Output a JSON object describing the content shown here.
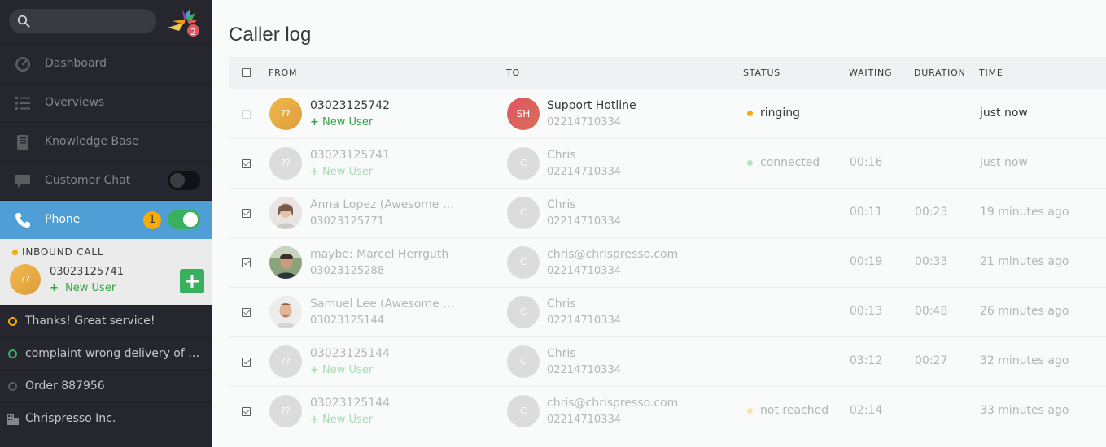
{
  "sidebar": {
    "search": {
      "placeholder": "",
      "value": ""
    },
    "logo_badge": "2",
    "nav": [
      {
        "label": "Dashboard",
        "icon": "dashboard-icon"
      },
      {
        "label": "Overviews",
        "icon": "list-icon"
      },
      {
        "label": "Knowledge Base",
        "icon": "book-icon"
      },
      {
        "label": "Customer Chat",
        "icon": "chat-icon",
        "toggle": false
      },
      {
        "label": "Phone",
        "icon": "phone-icon",
        "count": "1",
        "toggle": true,
        "active": true
      }
    ],
    "inbound": {
      "title": "INBOUND CALL",
      "avatar": "??",
      "number": "03023125741",
      "new_user": "New User"
    },
    "items": [
      {
        "label": "Thanks! Great service!",
        "icon": "ticket-open-icon",
        "color": "#faab00"
      },
      {
        "label": "complaint wrong delivery of ord...",
        "icon": "ticket-new-icon",
        "color": "#38ad69"
      },
      {
        "label": "Order 887956",
        "icon": "ticket-closed-icon",
        "color": "#5c5d60"
      },
      {
        "label": "Chrispresso Inc.",
        "icon": "organization-icon",
        "color": "#84868d"
      }
    ]
  },
  "main": {
    "title": "Caller log",
    "columns": [
      "FROM",
      "TO",
      "STATUS",
      "WAITING",
      "DURATION",
      "TIME"
    ],
    "rows": [
      {
        "checked": false,
        "from_avatar": "??",
        "from_avatar_type": "yellow",
        "from_name": "03023125742",
        "from_sub": "New User",
        "from_sub_is_link": true,
        "to_avatar": "SH",
        "to_avatar_type": "red",
        "to_name": "Support Hotline",
        "to_number": "02214710334",
        "status": "ringing",
        "status_color": "#faab00",
        "waiting": "",
        "duration": "",
        "time": "just now",
        "active": true
      },
      {
        "checked": true,
        "from_avatar": "??",
        "from_avatar_type": "grey",
        "from_name": "03023125741",
        "from_sub": "New User",
        "from_sub_is_link": true,
        "to_avatar": "C",
        "to_avatar_type": "grey",
        "to_name": "Chris",
        "to_number": "02214710334",
        "status": "connected",
        "status_color": "#b6e3c3",
        "waiting": "00:16",
        "duration": "",
        "time": "just now",
        "active": false
      },
      {
        "checked": true,
        "from_avatar": "",
        "from_avatar_type": "photo-woman",
        "from_name": "Anna Lopez (Awesome Cu...",
        "from_sub": "03023125771",
        "from_sub_is_link": false,
        "to_avatar": "C",
        "to_avatar_type": "grey",
        "to_name": "Chris",
        "to_number": "02214710334",
        "status": "",
        "status_color": "",
        "waiting": "00:11",
        "duration": "00:23",
        "time": "19 minutes ago",
        "active": false
      },
      {
        "checked": true,
        "from_avatar": "",
        "from_avatar_type": "photo-man-outdoor",
        "from_name": "maybe: Marcel Herrguth",
        "from_sub": "03023125288",
        "from_sub_is_link": false,
        "to_avatar": "C",
        "to_avatar_type": "grey",
        "to_name": "chris@chrispresso.com",
        "to_number": "02214710334",
        "status": "",
        "status_color": "",
        "waiting": "00:19",
        "duration": "00:33",
        "time": "21 minutes ago",
        "active": false
      },
      {
        "checked": true,
        "from_avatar": "",
        "from_avatar_type": "photo-man-beard",
        "from_name": "Samuel Lee (Awesome Cu...",
        "from_sub": "03023125144",
        "from_sub_is_link": false,
        "to_avatar": "C",
        "to_avatar_type": "grey",
        "to_name": "Chris",
        "to_number": "02214710334",
        "status": "",
        "status_color": "",
        "waiting": "00:13",
        "duration": "00:48",
        "time": "26 minutes ago",
        "active": false
      },
      {
        "checked": true,
        "from_avatar": "??",
        "from_avatar_type": "grey",
        "from_name": "03023125144",
        "from_sub": "New User",
        "from_sub_is_link": true,
        "to_avatar": "C",
        "to_avatar_type": "grey",
        "to_name": "Chris",
        "to_number": "02214710334",
        "status": "",
        "status_color": "",
        "waiting": "03:12",
        "duration": "00:27",
        "time": "32 minutes ago",
        "active": false
      },
      {
        "checked": true,
        "from_avatar": "??",
        "from_avatar_type": "grey",
        "from_name": "03023125144",
        "from_sub": "New User",
        "from_sub_is_link": true,
        "to_avatar": "C",
        "to_avatar_type": "grey",
        "to_name": "chris@chrispresso.com",
        "to_number": "02214710334",
        "status": "not reached",
        "status_color": "#fbe2a8",
        "waiting": "02:14",
        "duration": "",
        "time": "33 minutes ago",
        "active": false
      }
    ]
  },
  "colors": {
    "sidebar_bg": "#26272e",
    "accent": "#4f9ed5",
    "badge": "#faab00",
    "success": "#38b05e",
    "brand_red": "#e2565f"
  }
}
